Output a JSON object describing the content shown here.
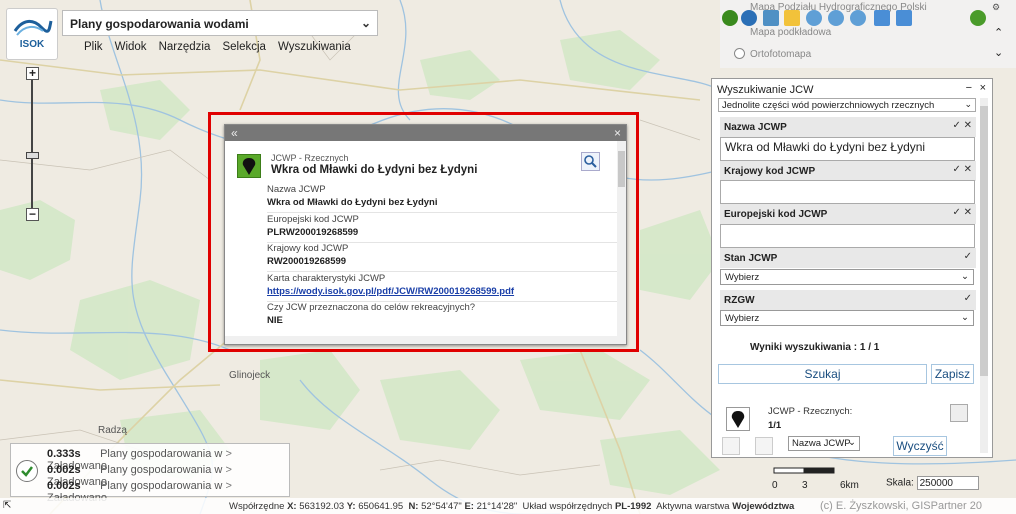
{
  "app": {
    "logo_text": "ISOK",
    "title": "Plany gospodarowania wodami",
    "menu": [
      "Plik",
      "Widok",
      "Narzędzia",
      "Selekcja",
      "Wyszukiwania"
    ]
  },
  "map": {
    "place_labels": [
      "Glinojeck",
      "Radzą"
    ]
  },
  "layers": {
    "items": [
      "Mapa Podziału Hydrograficznego Polski",
      "Mapa podkładowa",
      "Ortofotomapa"
    ]
  },
  "popup": {
    "collapse_glyph": "«",
    "close_glyph": "×",
    "feature_type": "JCWP - Rzecznych",
    "feature_title": "Wkra od Mławki do Łydyni bez Łydyni",
    "rows": [
      {
        "key": "Nazwa JCWP",
        "value": "Wkra od Mławki do Łydyni bez Łydyni"
      },
      {
        "key": "Europejski kod JCWP",
        "value": "PLRW200019268599"
      },
      {
        "key": "Krajowy kod JCWP",
        "value": "RW200019268599"
      },
      {
        "key": "Karta charakterystyki JCWP",
        "value": "https://wody.isok.gov.pl/pdf/JCW/RW200019268599.pdf"
      },
      {
        "key": "Czy JCW przeznaczona do celów rekreacyjnych?",
        "value": "NIE"
      }
    ]
  },
  "search_panel": {
    "title": "Wyszukiwanie JCW",
    "category": "Jednolite części wód powierzchniowych rzecznych",
    "fields": {
      "nazwa_label": "Nazwa JCWP",
      "nazwa_value": "Wkra od Mławki do Łydyni bez Łydyni",
      "krajowy_label": "Krajowy kod JCWP",
      "krajowy_value": "",
      "europejski_label": "Europejski kod JCWP",
      "europejski_value": "",
      "stan_label": "Stan JCWP",
      "stan_value": "Wybierz",
      "rzgw_label": "RZGW",
      "rzgw_value": "Wybierz"
    },
    "results_text": "Wyniki wyszukiwania : 1 / 1",
    "search_button": "Szukaj",
    "save_button": "Zapisz",
    "result_type": "JCWP - Rzecznych:",
    "result_count": "1/1",
    "sort_field": "Nazwa JCWP",
    "clear_button": "Wyczyść"
  },
  "status": {
    "rows": [
      {
        "time": "0.333s",
        "name": "Plany gospodarowania w",
        "arrow": ">",
        "state": "Załadowano"
      },
      {
        "time": "0.002s",
        "name": "Plany gospodarowania w",
        "arrow": ">",
        "state": "Załadowano"
      },
      {
        "time": "0.002s",
        "name": "Plany gospodarowania w",
        "arrow": ">",
        "state": "Załadowano"
      }
    ]
  },
  "scale": {
    "bar_labels": [
      "0",
      "3",
      "6km"
    ],
    "label": "Skala:",
    "value": "250000"
  },
  "footer": {
    "coords_label": "Współrzędne",
    "x_label": "X:",
    "x": "563192.03",
    "y_label": "Y:",
    "y": "650641.95",
    "n_label": "N:",
    "n": "52°54'47\"",
    "e_label": "E:",
    "e": "21°14'28\"",
    "system_label": "Układ współrzędnych",
    "system": "PL-1992",
    "active_label": "Aktywna warstwa",
    "active": "Województwa",
    "copyright": "(c) E. Żyszkowski, GISPartner 20"
  },
  "colors": {
    "highlight": "#e00000",
    "accent_green": "#5aa92a",
    "link": "#1a3fa8"
  }
}
